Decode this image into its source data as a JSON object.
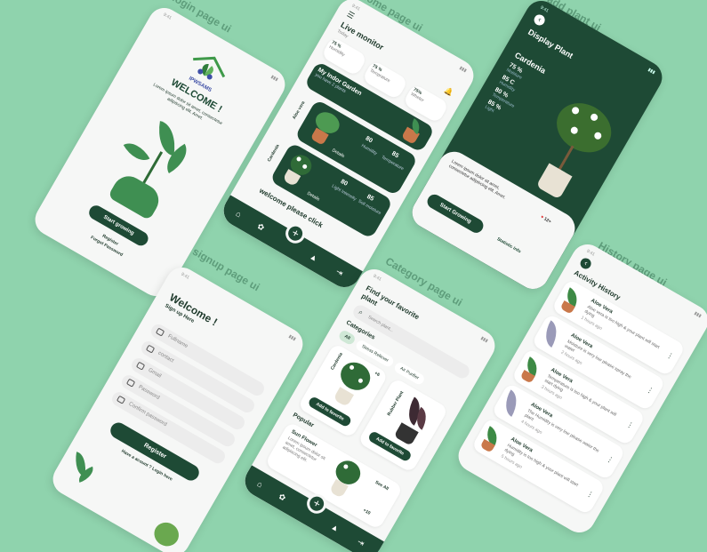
{
  "labels": {
    "login": "login page ui",
    "home": "home page ui",
    "add_plant": "add plant ui",
    "signup": "signup  page ui",
    "category": "Category page ui",
    "history": "History page ui"
  },
  "colors": {
    "background": "#8fd3ad",
    "primary": "#1e4a35",
    "screen": "#f6f7f6",
    "accent": "#3f8f52"
  },
  "login": {
    "logo_text": "IPWSAMS",
    "welcome": "WELCOME !",
    "description": "Lorem ipsum dolor sit amet, consectetur adipiscing elit. Amet.",
    "start_button": "Start growing",
    "register_link": "Register",
    "forgot_link": "Forgot Password"
  },
  "home": {
    "title": "Live monitor",
    "subtitle": "Today",
    "stats": [
      {
        "value": "75 %",
        "label": "Humidity"
      },
      {
        "value": "75 %",
        "label": "Temprature"
      },
      {
        "value": "75%",
        "label": "Wheter"
      }
    ],
    "banner_title": "My Indor Garden",
    "banner_sub": "you have 2 plants",
    "plants": [
      {
        "name": "Aloe vera",
        "t1": "80",
        "t2": "85",
        "l1": "Humidity",
        "l2": "Temperature",
        "action": "Details"
      },
      {
        "name": "Cardenia",
        "t1": "80",
        "t2": "85",
        "l1": "Light Intensity",
        "l2": "Soil moisture",
        "action": "Details"
      }
    ],
    "welcome_text": "welcome please click"
  },
  "add_plant": {
    "back": "‹",
    "title": "Display Plant",
    "plant_name": "Cardenia",
    "stats": [
      {
        "value": "75 %",
        "label": "Moisture"
      },
      {
        "value": "85 C",
        "label": "Humidity"
      },
      {
        "value": "80 %",
        "label": "Temperature"
      },
      {
        "value": "85 %",
        "label": "Light"
      }
    ],
    "description": "Lorem ipsum dolor sit amet, consectetur adipiscing elit. Amet.",
    "likes": "12+",
    "start_button": "Start Growing",
    "statistic_button": "Statistic info"
  },
  "signup": {
    "welcome": "Welcome !",
    "subtitle": "Sign up Here",
    "fields": [
      "Fullname",
      "contact",
      "Gmail",
      "Password",
      "Confirm password"
    ],
    "register_button": "Register",
    "login_link": "Have a acount ? Login here"
  },
  "category": {
    "title": "Find your favorite plant",
    "search_placeholder": "Search plant...",
    "categories_heading": "Categories",
    "chips": [
      "All",
      "Stress Reliever",
      "Air Purifier"
    ],
    "cards": [
      {
        "name": "Cardenia",
        "price": "+6",
        "button": "Add to favorite"
      },
      {
        "name": "Rubber Plant",
        "button": "Add to favorite"
      }
    ],
    "popular_heading": "Popular",
    "popular": {
      "name": "Sun Flower",
      "desc": "Lorem ipsum dolor sit amet, consectetur adipiscing elit.",
      "see_all": "See All",
      "count": "+10"
    }
  },
  "history": {
    "title": "Activity History",
    "items": [
      {
        "name": "Aloe Vera",
        "desc": "Aloe vera is too high & your plant will start dying",
        "time": "1 hours ago"
      },
      {
        "name": "Aloe Vera",
        "desc": "Moisture is very low please spray the water",
        "time": "2 hours ago"
      },
      {
        "name": "Aloe Vera",
        "desc": "Temperature is too high & your plant will start dying",
        "time": "3 hours ago"
      },
      {
        "name": "Aloe Vera",
        "desc": "The Humidity is very low please water the plant",
        "time": "4 hours ago"
      },
      {
        "name": "Aloe Vera",
        "desc": "Humidity is too high & your plant will start dying",
        "time": "5 hours ago"
      }
    ]
  }
}
